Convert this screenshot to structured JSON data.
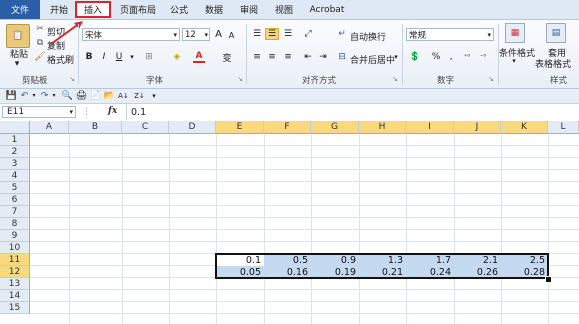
{
  "tabs": {
    "file": "文件",
    "items": [
      "开始",
      "插入",
      "页面布局",
      "公式",
      "数据",
      "审阅",
      "视图",
      "Acrobat"
    ]
  },
  "ribbon": {
    "clipboard": {
      "paste": "粘贴",
      "cut": "剪切",
      "copy": "复制",
      "format_painter": "格式刷",
      "label": "剪贴板"
    },
    "font": {
      "name": "宋体",
      "size": "12",
      "label": "字体",
      "bold": "B",
      "italic": "I",
      "underline": "U",
      "grow": "A",
      "shrink": "A",
      "font_color": "A",
      "phonetic": "变"
    },
    "alignment": {
      "wrap": "自动换行",
      "merge": "合并后居中",
      "label": "对齐方式"
    },
    "number": {
      "format": "常规",
      "percent": "%",
      "comma": ",",
      "label": "数字"
    },
    "styles": {
      "conditional": "条件格式",
      "table_format_top": "套用",
      "table_format": "表格格式",
      "label": "样式"
    }
  },
  "formula_bar": {
    "name_box": "E11",
    "fx": "fx",
    "value": "0.1"
  },
  "grid": {
    "columns": [
      "A",
      "B",
      "C",
      "D",
      "E",
      "F",
      "G",
      "H",
      "I",
      "J",
      "K",
      "L"
    ],
    "rows": [
      "1",
      "2",
      "3",
      "4",
      "5",
      "6",
      "7",
      "8",
      "9",
      "10",
      "11",
      "12",
      "13",
      "14",
      "15"
    ],
    "row11": [
      "0.1",
      "0.5",
      "0.9",
      "1.3",
      "1.7",
      "2.1",
      "2.5"
    ],
    "row12": [
      "0.05",
      "0.16",
      "0.19",
      "0.21",
      "0.24",
      "0.26",
      "0.28"
    ]
  },
  "colors": {
    "file_tab": "#2a5fa8",
    "selection": "#c5d9f1",
    "header_highlight": "#f8d980",
    "highlight_box": "#d62828"
  }
}
